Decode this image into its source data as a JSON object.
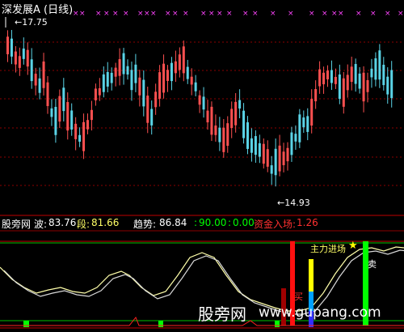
{
  "window": {
    "title": "深发展A (日线)"
  },
  "main_chart": {
    "high_label": "17.75",
    "low_label": "14.93",
    "colors": {
      "up": "#ff5050",
      "down": "#5ad3e6",
      "grid": "#8b0000",
      "marker": "#ff44ff"
    }
  },
  "indicator_bar": {
    "site": "股旁网",
    "wave_label": "波:",
    "wave_value": "83.76",
    "segment_label": "段:",
    "segment_value": "81.66",
    "trend_label": "趋势:",
    "trend_value": "86.84",
    "val1_sep": ":",
    "val1": "90.00",
    "val2_sep": ":",
    "val2": "0.00",
    "capital_label": "资金入场:",
    "capital_value": "1.26",
    "colors": {
      "wave": "#ffff66",
      "segment": "#ffff66",
      "trend": "#ffffff",
      "green": "#00ff00",
      "red": "#ff3030"
    }
  },
  "sub_chart": {
    "annotation_main": "主力进场",
    "annotation_buy": "买",
    "annotation_sell": "卖",
    "star": "★"
  },
  "watermark": {
    "cn": "股旁网",
    "url": "www.gupang.com"
  }
}
